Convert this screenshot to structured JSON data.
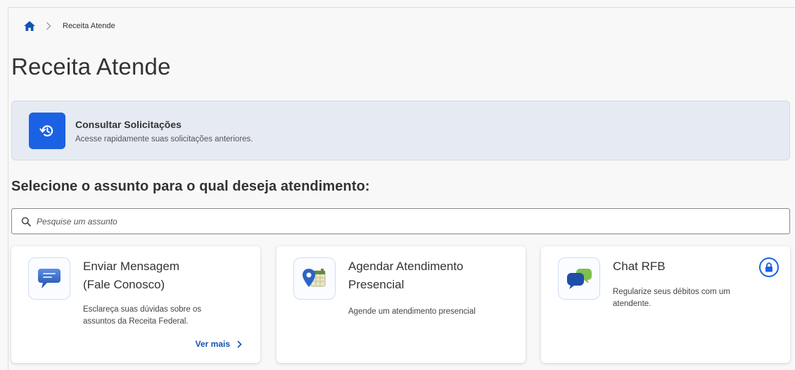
{
  "breadcrumb": {
    "home_icon": "home-icon",
    "separator_icon": "chevron-right-icon",
    "current": "Receita Atende"
  },
  "page": {
    "title": "Receita Atende"
  },
  "consult": {
    "icon": "history-icon",
    "title": "Consultar Solicitações",
    "description": "Acesse rapidamente suas solicitações anteriores."
  },
  "section": {
    "title": "Selecione o assunto para o qual deseja atendimento:"
  },
  "search": {
    "icon": "search-icon",
    "placeholder": "Pesquise um assunto",
    "value": ""
  },
  "cards": [
    {
      "icon": "message-bubble-icon",
      "title_line1": "Enviar Mensagem",
      "title_line2": "(Fale Conosco)",
      "desc_line1": "Esclareça suas dúvidas sobre os",
      "desc_line2": "assuntos da Receita Federal.",
      "link": "Ver mais"
    },
    {
      "icon": "calendar-location-icon",
      "title_line1": "Agendar Atendimento",
      "title_line2": "Presencial",
      "desc_line1": "Agende um atendimento presencial",
      "desc_line2": ""
    },
    {
      "icon": "chat-bubbles-icon",
      "title_line1": "Chat RFB",
      "title_line2": "",
      "desc_line1": "Regularize seus débitos com um",
      "desc_line2": "atendente.",
      "badge_icon": "lock-icon"
    }
  ],
  "colors": {
    "primary": "#1351b4",
    "accent": "#1b61e4",
    "consult_bg": "#e6eaf3",
    "page_bg": "#f8f8f8"
  }
}
